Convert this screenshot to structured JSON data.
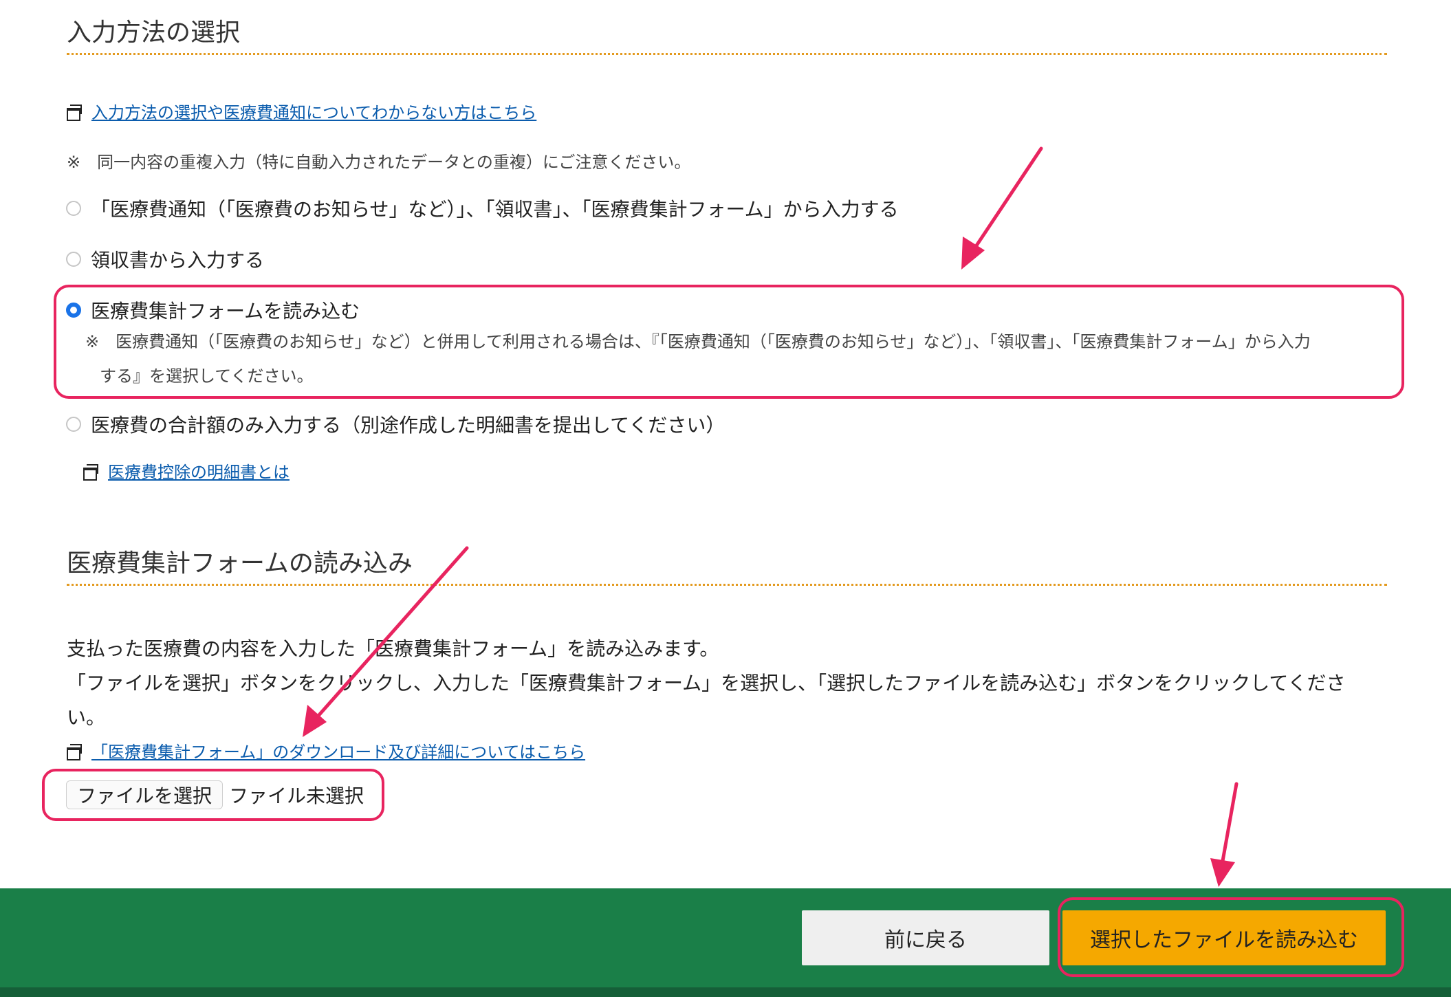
{
  "section1": {
    "title": "入力方法の選択",
    "help_link": "入力方法の選択や医療費通知についてわからない方はこちら",
    "note": "※　同一内容の重複入力（特に自動入力されたデータとの重複）にご注意ください。",
    "options": [
      {
        "label": "「医療費通知（「医療費のお知らせ」など）」、「領収書」、「医療費集計フォーム」から入力する",
        "checked": false
      },
      {
        "label": "領収書から入力する",
        "checked": false
      },
      {
        "label": "医療費集計フォームを読み込む",
        "checked": true
      },
      {
        "label": "医療費の合計額のみ入力する（別途作成した明細書を提出してください）",
        "checked": false
      }
    ],
    "selected_note_line1": "※　医療費通知（「医療費のお知らせ」など）と併用して利用される場合は、『「医療費通知（「医療費のお知らせ」など）」、「領収書」、「医療費集計フォーム」から入力",
    "selected_note_line2": "する』を選択してください。",
    "statement_link": "医療費控除の明細書とは"
  },
  "section2": {
    "title": "医療費集計フォームの読み込み",
    "desc_line1": "支払った医療費の内容を入力した「医療費集計フォーム」を読み込みます。",
    "desc_line2": "「ファイルを選択」ボタンをクリックし、入力した「医療費集計フォーム」を選択し、「選択したファイルを読み込む」ボタンをクリックしてくださ",
    "desc_line3": "い。",
    "download_link": "「医療費集計フォーム」のダウンロード及び詳細についてはこちら",
    "file_button": "ファイルを選択",
    "file_status": "ファイル未選択"
  },
  "footer": {
    "back_button": "前に戻る",
    "load_button": "選択したファイルを読み込む"
  },
  "colors": {
    "accent_divider": "#e39a1f",
    "footer_bg": "#1a7f48",
    "primary_button": "#f5a800",
    "annotation": "#e8245f",
    "link": "#0b5cad"
  }
}
